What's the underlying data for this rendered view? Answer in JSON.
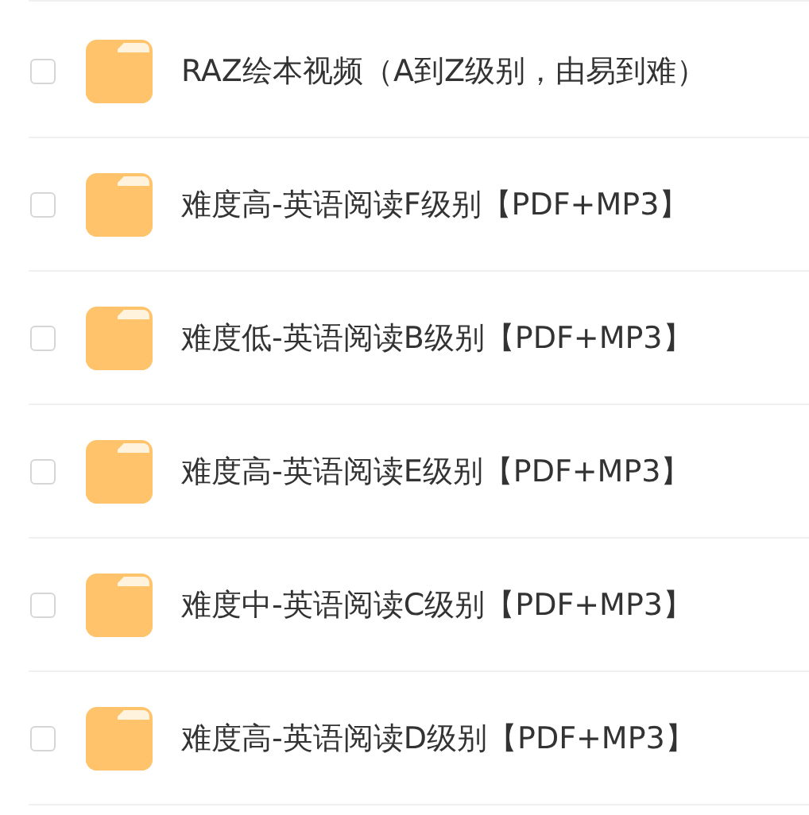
{
  "files": [
    {
      "name": "RAZ绘本视频（A到Z级别，由易到难）",
      "checked": false
    },
    {
      "name": "难度高-英语阅读F级别【PDF+MP3】",
      "checked": false
    },
    {
      "name": "难度低-英语阅读B级别【PDF+MP3】",
      "checked": false
    },
    {
      "name": "难度高-英语阅读E级别【PDF+MP3】",
      "checked": false
    },
    {
      "name": "难度中-英语阅读C级别【PDF+MP3】",
      "checked": false
    },
    {
      "name": "难度高-英语阅读D级别【PDF+MP3】",
      "checked": false
    }
  ]
}
